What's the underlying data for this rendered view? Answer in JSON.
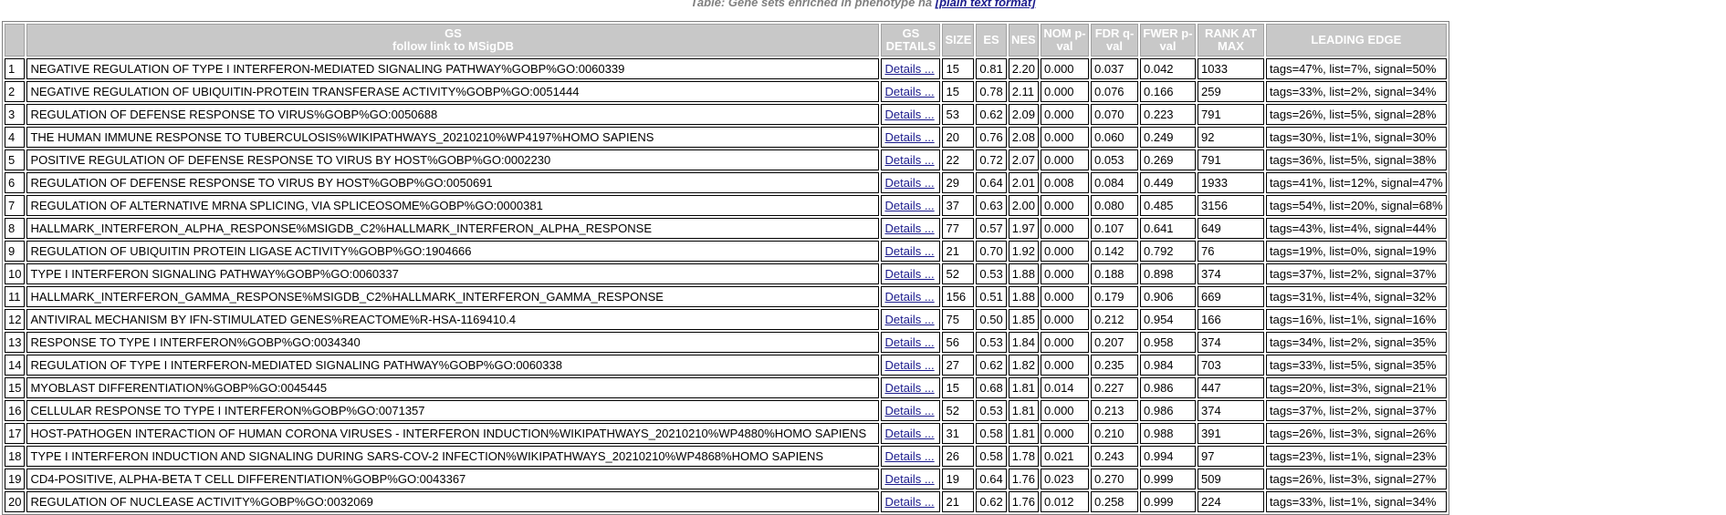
{
  "caption": {
    "text": "Table: Gene sets enriched in phenotype ",
    "phenotype": "na",
    "link": "[plain text format]"
  },
  "columns": {
    "gs_line1": "GS",
    "gs_line2": "follow link to MSigDB",
    "details": "GS DETAILS",
    "size": "SIZE",
    "es": "ES",
    "nes": "NES",
    "nom": "NOM p-val",
    "fdr": "FDR q-val",
    "fwer": "FWER p-val",
    "rank": "RANK AT MAX",
    "edge": "LEADING EDGE"
  },
  "rows": [
    {
      "idx": "1",
      "name": "NEGATIVE REGULATION OF TYPE I INTERFERON-MEDIATED SIGNALING PATHWAY%GOBP%GO:0060339",
      "details": "Details ...",
      "size": "15",
      "es": "0.81",
      "nes": "2.20",
      "nom": "0.000",
      "fdr": "0.037",
      "fwer": "0.042",
      "rank": "1033",
      "edge": "tags=47%, list=7%, signal=50%"
    },
    {
      "idx": "2",
      "name": "NEGATIVE REGULATION OF UBIQUITIN-PROTEIN TRANSFERASE ACTIVITY%GOBP%GO:0051444",
      "details": "Details ...",
      "size": "15",
      "es": "0.78",
      "nes": "2.11",
      "nom": "0.000",
      "fdr": "0.076",
      "fwer": "0.166",
      "rank": "259",
      "edge": "tags=33%, list=2%, signal=34%"
    },
    {
      "idx": "3",
      "name": "REGULATION OF DEFENSE RESPONSE TO VIRUS%GOBP%GO:0050688",
      "details": "Details ...",
      "size": "53",
      "es": "0.62",
      "nes": "2.09",
      "nom": "0.000",
      "fdr": "0.070",
      "fwer": "0.223",
      "rank": "791",
      "edge": "tags=26%, list=5%, signal=28%"
    },
    {
      "idx": "4",
      "name": "THE HUMAN IMMUNE RESPONSE TO TUBERCULOSIS%WIKIPATHWAYS_20210210%WP4197%HOMO SAPIENS",
      "details": "Details ...",
      "size": "20",
      "es": "0.76",
      "nes": "2.08",
      "nom": "0.000",
      "fdr": "0.060",
      "fwer": "0.249",
      "rank": "92",
      "edge": "tags=30%, list=1%, signal=30%"
    },
    {
      "idx": "5",
      "name": "POSITIVE REGULATION OF DEFENSE RESPONSE TO VIRUS BY HOST%GOBP%GO:0002230",
      "details": "Details ...",
      "size": "22",
      "es": "0.72",
      "nes": "2.07",
      "nom": "0.000",
      "fdr": "0.053",
      "fwer": "0.269",
      "rank": "791",
      "edge": "tags=36%, list=5%, signal=38%"
    },
    {
      "idx": "6",
      "name": "REGULATION OF DEFENSE RESPONSE TO VIRUS BY HOST%GOBP%GO:0050691",
      "details": "Details ...",
      "size": "29",
      "es": "0.64",
      "nes": "2.01",
      "nom": "0.008",
      "fdr": "0.084",
      "fwer": "0.449",
      "rank": "1933",
      "edge": "tags=41%, list=12%, signal=47%"
    },
    {
      "idx": "7",
      "name": "REGULATION OF ALTERNATIVE MRNA SPLICING, VIA SPLICEOSOME%GOBP%GO:0000381",
      "details": "Details ...",
      "size": "37",
      "es": "0.63",
      "nes": "2.00",
      "nom": "0.000",
      "fdr": "0.080",
      "fwer": "0.485",
      "rank": "3156",
      "edge": "tags=54%, list=20%, signal=68%"
    },
    {
      "idx": "8",
      "name": "HALLMARK_INTERFERON_ALPHA_RESPONSE%MSIGDB_C2%HALLMARK_INTERFERON_ALPHA_RESPONSE",
      "details": "Details ...",
      "size": "77",
      "es": "0.57",
      "nes": "1.97",
      "nom": "0.000",
      "fdr": "0.107",
      "fwer": "0.641",
      "rank": "649",
      "edge": "tags=43%, list=4%, signal=44%"
    },
    {
      "idx": "9",
      "name": "REGULATION OF UBIQUITIN PROTEIN LIGASE ACTIVITY%GOBP%GO:1904666",
      "details": "Details ...",
      "size": "21",
      "es": "0.70",
      "nes": "1.92",
      "nom": "0.000",
      "fdr": "0.142",
      "fwer": "0.792",
      "rank": "76",
      "edge": "tags=19%, list=0%, signal=19%"
    },
    {
      "idx": "10",
      "name": "TYPE I INTERFERON SIGNALING PATHWAY%GOBP%GO:0060337",
      "details": "Details ...",
      "size": "52",
      "es": "0.53",
      "nes": "1.88",
      "nom": "0.000",
      "fdr": "0.188",
      "fwer": "0.898",
      "rank": "374",
      "edge": "tags=37%, list=2%, signal=37%"
    },
    {
      "idx": "11",
      "name": "HALLMARK_INTERFERON_GAMMA_RESPONSE%MSIGDB_C2%HALLMARK_INTERFERON_GAMMA_RESPONSE",
      "details": "Details ...",
      "size": "156",
      "es": "0.51",
      "nes": "1.88",
      "nom": "0.000",
      "fdr": "0.179",
      "fwer": "0.906",
      "rank": "669",
      "edge": "tags=31%, list=4%, signal=32%"
    },
    {
      "idx": "12",
      "name": "ANTIVIRAL MECHANISM BY IFN-STIMULATED GENES%REACTOME%R-HSA-1169410.4",
      "details": "Details ...",
      "size": "75",
      "es": "0.50",
      "nes": "1.85",
      "nom": "0.000",
      "fdr": "0.212",
      "fwer": "0.954",
      "rank": "166",
      "edge": "tags=16%, list=1%, signal=16%"
    },
    {
      "idx": "13",
      "name": "RESPONSE TO TYPE I INTERFERON%GOBP%GO:0034340",
      "details": "Details ...",
      "size": "56",
      "es": "0.53",
      "nes": "1.84",
      "nom": "0.000",
      "fdr": "0.207",
      "fwer": "0.958",
      "rank": "374",
      "edge": "tags=34%, list=2%, signal=35%"
    },
    {
      "idx": "14",
      "name": "REGULATION OF TYPE I INTERFERON-MEDIATED SIGNALING PATHWAY%GOBP%GO:0060338",
      "details": "Details ...",
      "size": "27",
      "es": "0.62",
      "nes": "1.82",
      "nom": "0.000",
      "fdr": "0.235",
      "fwer": "0.984",
      "rank": "703",
      "edge": "tags=33%, list=5%, signal=35%"
    },
    {
      "idx": "15",
      "name": "MYOBLAST DIFFERENTIATION%GOBP%GO:0045445",
      "details": "Details ...",
      "size": "15",
      "es": "0.68",
      "nes": "1.81",
      "nom": "0.014",
      "fdr": "0.227",
      "fwer": "0.986",
      "rank": "447",
      "edge": "tags=20%, list=3%, signal=21%"
    },
    {
      "idx": "16",
      "name": "CELLULAR RESPONSE TO TYPE I INTERFERON%GOBP%GO:0071357",
      "details": "Details ...",
      "size": "52",
      "es": "0.53",
      "nes": "1.81",
      "nom": "0.000",
      "fdr": "0.213",
      "fwer": "0.986",
      "rank": "374",
      "edge": "tags=37%, list=2%, signal=37%"
    },
    {
      "idx": "17",
      "name": "HOST-PATHOGEN INTERACTION OF HUMAN CORONA VIRUSES - INTERFERON INDUCTION%WIKIPATHWAYS_20210210%WP4880%HOMO SAPIENS",
      "details": "Details ...",
      "size": "31",
      "es": "0.58",
      "nes": "1.81",
      "nom": "0.000",
      "fdr": "0.210",
      "fwer": "0.988",
      "rank": "391",
      "edge": "tags=26%, list=3%, signal=26%"
    },
    {
      "idx": "18",
      "name": "TYPE I INTERFERON INDUCTION AND SIGNALING DURING SARS-COV-2 INFECTION%WIKIPATHWAYS_20210210%WP4868%HOMO SAPIENS",
      "details": "Details ...",
      "size": "26",
      "es": "0.58",
      "nes": "1.78",
      "nom": "0.021",
      "fdr": "0.243",
      "fwer": "0.994",
      "rank": "97",
      "edge": "tags=23%, list=1%, signal=23%"
    },
    {
      "idx": "19",
      "name": "CD4-POSITIVE, ALPHA-BETA T CELL DIFFERENTIATION%GOBP%GO:0043367",
      "details": "Details ...",
      "size": "19",
      "es": "0.64",
      "nes": "1.76",
      "nom": "0.023",
      "fdr": "0.270",
      "fwer": "0.999",
      "rank": "509",
      "edge": "tags=26%, list=3%, signal=27%"
    },
    {
      "idx": "20",
      "name": "REGULATION OF NUCLEASE ACTIVITY%GOBP%GO:0032069",
      "details": "Details ...",
      "size": "21",
      "es": "0.62",
      "nes": "1.76",
      "nom": "0.012",
      "fdr": "0.258",
      "fwer": "0.999",
      "rank": "224",
      "edge": "tags=33%, list=1%, signal=34%"
    }
  ]
}
